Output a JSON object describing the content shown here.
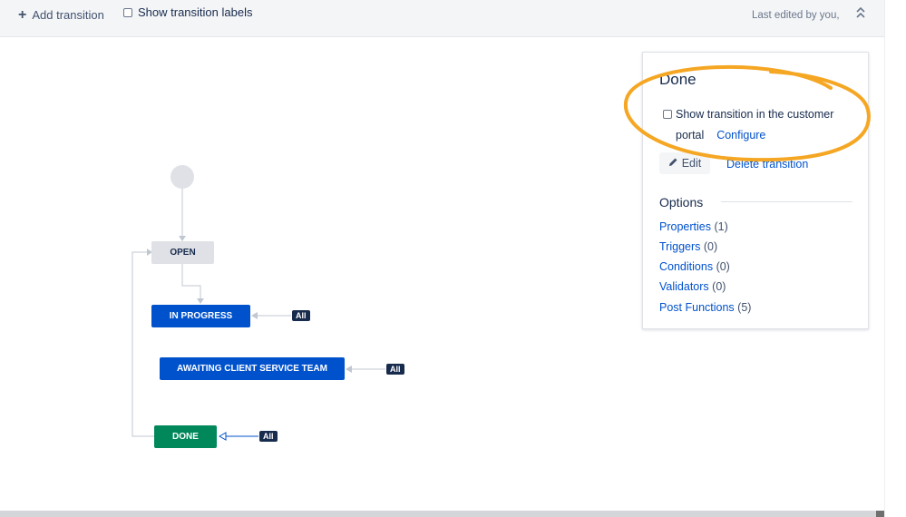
{
  "toolbar": {
    "add_transition_label": "Add transition",
    "show_labels_label": "Show transition labels",
    "last_edited": "Last edited by you,",
    "collapse_icon": "double-chevron-up-icon"
  },
  "diagram": {
    "statuses": [
      {
        "label": "OPEN",
        "color": "#dfe1e6",
        "text_color": "#172b4d"
      },
      {
        "label": "IN PROGRESS",
        "color": "#0052cc",
        "text_color": "#ffffff"
      },
      {
        "label": "AWAITING CLIENT SERVICE TEAM",
        "color": "#0052cc",
        "text_color": "#ffffff"
      },
      {
        "label": "DONE",
        "color": "#00875a",
        "text_color": "#ffffff"
      }
    ],
    "global_tags": [
      "All",
      "All",
      "All"
    ]
  },
  "panel": {
    "title": "Done",
    "portal_checkbox_line1": "Show transition in the customer",
    "portal_checkbox_line2": "portal",
    "configure_link": "Configure",
    "edit_label": "Edit",
    "delete_link": "Delete transition",
    "options_title": "Options",
    "options": [
      {
        "label": "Properties",
        "count": "(1)"
      },
      {
        "label": "Triggers",
        "count": "(0)"
      },
      {
        "label": "Conditions",
        "count": "(0)"
      },
      {
        "label": "Validators",
        "count": "(0)"
      },
      {
        "label": "Post Functions",
        "count": "(5)"
      }
    ]
  },
  "annotation": {
    "highlight_color": "#f5a623"
  }
}
